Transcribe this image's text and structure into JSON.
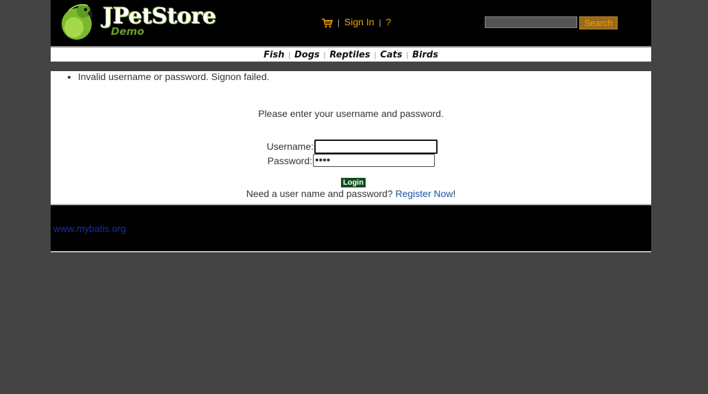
{
  "header": {
    "brand": "JPetStore",
    "subtitle": "Demo",
    "cart_icon": "shopping-cart-icon",
    "sign_in": "Sign In",
    "help": "?",
    "separator": "|",
    "search": {
      "value": "",
      "placeholder": "",
      "button": "Search"
    }
  },
  "quicklinks": [
    "Fish",
    "Dogs",
    "Reptiles",
    "Cats",
    "Birds"
  ],
  "messages": [
    "Invalid username or password. Signon failed."
  ],
  "signon": {
    "prompt": "Please enter your username and password.",
    "username_label": "Username:",
    "username_value": "",
    "password_label": "Password:",
    "password_value": "••••",
    "login_button": "Login",
    "register_prompt": "Need a user name and password?",
    "register_link": "Register Now",
    "register_suffix": "!"
  },
  "footer": {
    "link": "www.mybatis.org"
  },
  "colors": {
    "accent": "#f0a30a",
    "link": "#1a4ea0",
    "login_bg": "#0d4d1a"
  }
}
